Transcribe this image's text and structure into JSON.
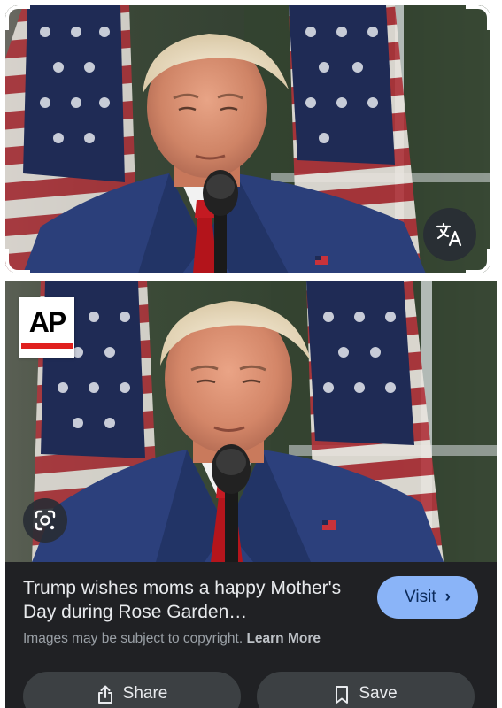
{
  "top_image": {
    "alt": "",
    "translate_button_icon": "translate-icon"
  },
  "result": {
    "source_logo_text": "AP",
    "lens_button_icon": "lens-icon",
    "title": "Trump wishes moms a happy Mother's Day during Rose Garden…",
    "visit_label": "Visit",
    "visit_chevron": "›",
    "copyright_text": "Images may be subject to copyright.",
    "learn_more_label": "Learn More",
    "share_label": "Share",
    "save_label": "Save"
  },
  "colors": {
    "card_background": "#202124",
    "visit_button": "#8ab4f8",
    "action_button": "#3c4043",
    "ap_red": "#e0201e"
  }
}
